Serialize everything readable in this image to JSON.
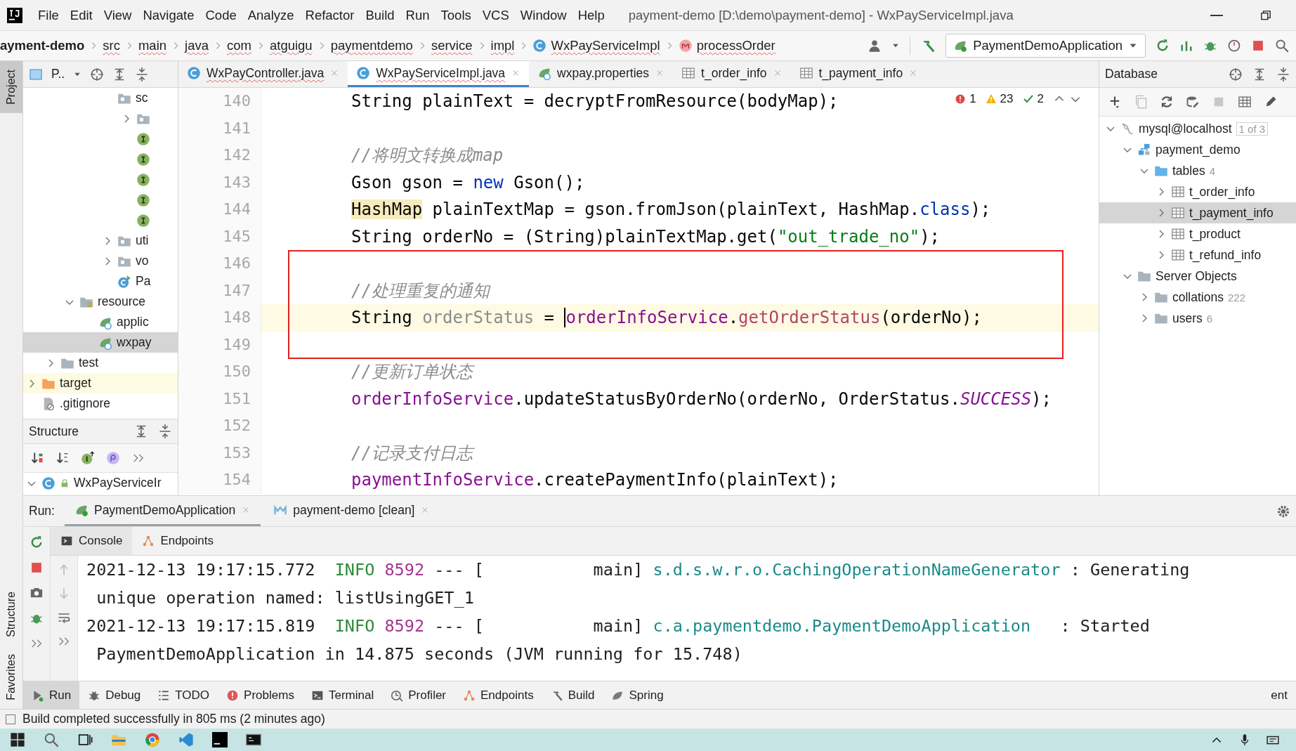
{
  "window": {
    "title": "payment-demo [D:\\demo\\payment-demo] - WxPayServiceImpl.java"
  },
  "menu": [
    "File",
    "Edit",
    "View",
    "Navigate",
    "Code",
    "Analyze",
    "Refactor",
    "Build",
    "Run",
    "Tools",
    "VCS",
    "Window",
    "Help"
  ],
  "breadcrumbs": [
    {
      "label": "ayment-demo",
      "kind": "project"
    },
    {
      "label": "src",
      "kind": "folder"
    },
    {
      "label": "main",
      "kind": "folder"
    },
    {
      "label": "java",
      "kind": "folder"
    },
    {
      "label": "com",
      "kind": "folder"
    },
    {
      "label": "atguigu",
      "kind": "folder"
    },
    {
      "label": "paymentdemo",
      "kind": "folder"
    },
    {
      "label": "service",
      "kind": "folder"
    },
    {
      "label": "impl",
      "kind": "folder"
    },
    {
      "label": "WxPayServiceImpl",
      "kind": "class"
    },
    {
      "label": "processOrder",
      "kind": "method"
    }
  ],
  "run_config": {
    "label": "PaymentDemoApplication"
  },
  "left_stripe": [
    {
      "label": "Project",
      "selected": true,
      "kind": "top"
    },
    {
      "label": "Structure",
      "selected": false,
      "kind": "bottom"
    },
    {
      "label": "Favorites",
      "selected": false,
      "kind": "bottom"
    }
  ],
  "project_panel": {
    "title": "P..",
    "tree": [
      {
        "children": [
          {
            "children": [
              {
                "children": [
                  {
                    "children": [
                      {
                        "label": "sc",
                        "kind": "package",
                        "selected": false,
                        "children": [
                          {
                            "kind": "package",
                            "expanded": false,
                            "selected": false
                          },
                          {
                            "kind": "interface",
                            "selected": false
                          },
                          {
                            "kind": "interface",
                            "selected": false
                          },
                          {
                            "kind": "interface",
                            "selected": false
                          },
                          {
                            "kind": "interface",
                            "selected": false
                          },
                          {
                            "kind": "interface",
                            "selected": false
                          }
                        ]
                      },
                      {
                        "label": "uti",
                        "kind": "package",
                        "expanded": false,
                        "selected": false
                      },
                      {
                        "label": "vo",
                        "kind": "package",
                        "expanded": false,
                        "selected": false
                      },
                      {
                        "label": "Pa",
                        "kind": "spring-class",
                        "selected": false
                      }
                    ]
                  }
                ]
              },
              {
                "label": "resource",
                "kind": "resources",
                "expanded": true,
                "selected": false,
                "children": [
                  {
                    "label": "applic",
                    "kind": "spring-file",
                    "selected": false
                  },
                  {
                    "label": "wxpay",
                    "kind": "spring-file",
                    "selected": true
                  }
                ]
              }
            ]
          },
          {
            "label": "test",
            "kind": "folder",
            "expanded": false,
            "selected": false
          }
        ]
      },
      {
        "label": "target",
        "kind": "excluded-folder",
        "expanded": false,
        "selected": false
      },
      {
        "label": ".gitignore",
        "kind": "ignore-file",
        "selected": false
      }
    ]
  },
  "structure_panel": {
    "title": "Structure",
    "tree": [
      {
        "label": "WxPayServiceIr",
        "kind": "class-locked",
        "expanded": true,
        "selected": false
      }
    ]
  },
  "editor": {
    "tabs": [
      {
        "label": "WxPayController.java",
        "kind": "class",
        "selected": false
      },
      {
        "label": "WxPayServiceImpl.java",
        "kind": "class",
        "selected": true
      },
      {
        "label": "wxpay.properties",
        "kind": "spring-file",
        "selected": false
      },
      {
        "label": "t_order_info",
        "kind": "table",
        "selected": false
      },
      {
        "label": "t_payment_info",
        "kind": "table",
        "selected": false
      }
    ],
    "inspections": {
      "errors": "1",
      "warnings": "23",
      "weak_warnings": "2"
    },
    "lines": [
      {
        "number": "140",
        "current": false,
        "in_box": false,
        "tokens": [
          {
            "kind": "plain",
            "text": "String plainText = decryptFromResource(bodyMap);"
          }
        ]
      },
      {
        "number": "141",
        "current": false,
        "in_box": false
      },
      {
        "number": "142",
        "current": false,
        "in_box": false,
        "tokens": [
          {
            "kind": "comment",
            "text": "//将明文转换成map"
          }
        ]
      },
      {
        "number": "143",
        "current": false,
        "in_box": false,
        "tokens": [
          {
            "kind": "plain",
            "text": "Gson gson = "
          },
          {
            "kind": "keyword",
            "text": "new"
          },
          {
            "kind": "plain",
            "text": " Gson();"
          }
        ]
      },
      {
        "number": "144",
        "current": false,
        "in_box": false,
        "tokens": [
          {
            "kind": "warning",
            "text": "HashMap"
          },
          {
            "kind": "plain",
            "text": " plainTextMap = gson.fromJson(plainText, HashMap."
          },
          {
            "kind": "keyword",
            "text": "class"
          },
          {
            "kind": "plain",
            "text": ");"
          }
        ]
      },
      {
        "number": "145",
        "current": false,
        "in_box": false,
        "tokens": [
          {
            "kind": "plain",
            "text": "String orderNo = (String)plainTextMap.get("
          },
          {
            "kind": "string",
            "text": "\"out_trade_no\""
          },
          {
            "kind": "plain",
            "text": ");"
          }
        ]
      },
      {
        "number": "146",
        "current": false,
        "in_box": true
      },
      {
        "number": "147",
        "current": false,
        "in_box": true,
        "tokens": [
          {
            "kind": "comment",
            "text": "//处理重复的通知"
          }
        ]
      },
      {
        "number": "148",
        "current": true,
        "in_box": true,
        "tokens": [
          {
            "kind": "plain",
            "text": "String "
          },
          {
            "kind": "unused",
            "text": "orderStatus"
          },
          {
            "kind": "plain",
            "text": " = "
          },
          {
            "kind": "field",
            "text": "orderInfoService"
          },
          {
            "kind": "plain",
            "text": "."
          },
          {
            "kind": "method",
            "text": "getOrderStatus"
          },
          {
            "kind": "plain",
            "text": "(orderNo);"
          }
        ]
      },
      {
        "number": "149",
        "current": false,
        "in_box": true
      },
      {
        "number": "150",
        "current": false,
        "in_box": false,
        "tokens": [
          {
            "kind": "comment",
            "text": "//更新订单状态"
          }
        ]
      },
      {
        "number": "151",
        "current": false,
        "in_box": false,
        "tokens": [
          {
            "kind": "field",
            "text": "orderInfoService"
          },
          {
            "kind": "plain",
            "text": ".updateStatusByOrderNo(orderNo, OrderStatus."
          },
          {
            "kind": "constant",
            "text": "SUCCESS"
          },
          {
            "kind": "plain",
            "text": ");"
          }
        ]
      },
      {
        "number": "152",
        "current": false,
        "in_box": false
      },
      {
        "number": "153",
        "current": false,
        "in_box": false,
        "tokens": [
          {
            "kind": "comment",
            "text": "//记录支付日志"
          }
        ]
      },
      {
        "number": "154",
        "current": false,
        "in_box": false,
        "tokens": [
          {
            "kind": "field",
            "text": "paymentInfoService"
          },
          {
            "kind": "plain",
            "text": ".createPaymentInfo(plainText);"
          }
        ]
      }
    ]
  },
  "database_panel": {
    "title": "Database",
    "tree": [
      {
        "label": "mysql@localhost",
        "badge": "1 of 3",
        "kind": "connection",
        "expanded": true,
        "selected": false,
        "children": [
          {
            "label": "payment_demo",
            "kind": "schema",
            "expanded": true,
            "selected": false,
            "children": [
              {
                "label": "tables",
                "count": "4",
                "kind": "folder-blue",
                "expanded": true,
                "selected": false,
                "children": [
                  {
                    "label": "t_order_info",
                    "kind": "table",
                    "expanded": false,
                    "selected": false
                  },
                  {
                    "label": "t_payment_info",
                    "kind": "table",
                    "expanded": false,
                    "selected": true
                  },
                  {
                    "label": "t_product",
                    "kind": "table",
                    "expanded": false,
                    "selected": false
                  },
                  {
                    "label": "t_refund_info",
                    "kind": "table",
                    "expanded": false,
                    "selected": false
                  }
                ]
              }
            ]
          },
          {
            "label": "Server Objects",
            "kind": "folder",
            "expanded": true,
            "selected": false,
            "children": [
              {
                "label": "collations",
                "count": "222",
                "kind": "folder",
                "expanded": false,
                "selected": false
              },
              {
                "label": "users",
                "count": "6",
                "kind": "folder",
                "expanded": false,
                "selected": false
              }
            ]
          }
        ]
      }
    ]
  },
  "run_panel": {
    "label": "Run:",
    "tabs": [
      {
        "label": "PaymentDemoApplication",
        "kind": "spring-run",
        "selected": true
      },
      {
        "label": "payment-demo [clean]",
        "kind": "module",
        "selected": false
      }
    ],
    "subtabs": [
      {
        "label": "Console",
        "kind": "console",
        "selected": true
      },
      {
        "label": "Endpoints",
        "kind": "endpoints",
        "selected": false
      }
    ],
    "console": [
      {
        "tokens": [
          {
            "kind": "plain",
            "text": "2021-12-13 19:17:15.772  "
          },
          {
            "kind": "info",
            "text": "INFO "
          },
          {
            "kind": "pid",
            "text": "8592"
          },
          {
            "kind": "plain",
            "text": " --- [           main] "
          },
          {
            "kind": "logger",
            "text": "s.d.s.w.r.o.CachingOperationNameGenerator"
          },
          {
            "kind": "plain",
            "text": " : Generating"
          }
        ]
      },
      {
        "tokens": [
          {
            "kind": "plain",
            "text": " unique operation named: listUsingGET_1"
          }
        ]
      },
      {
        "tokens": [
          {
            "kind": "plain",
            "text": "2021-12-13 19:17:15.819  "
          },
          {
            "kind": "info",
            "text": "INFO "
          },
          {
            "kind": "pid",
            "text": "8592"
          },
          {
            "kind": "plain",
            "text": " --- [           main] "
          },
          {
            "kind": "logger",
            "text": "c.a.paymentdemo.PaymentDemoApplication"
          },
          {
            "kind": "plain",
            "text": "   : Started"
          }
        ]
      },
      {
        "tokens": [
          {
            "kind": "plain",
            "text": " PaymentDemoApplication in 14.875 seconds (JVM running for 15.748)"
          }
        ]
      }
    ]
  },
  "tool_tabs": [
    {
      "label": "Run",
      "kind": "run",
      "selected": true
    },
    {
      "label": "Debug",
      "kind": "bug",
      "selected": false
    },
    {
      "label": "TODO",
      "kind": "list",
      "selected": false
    },
    {
      "label": "Problems",
      "kind": "problems",
      "selected": false
    },
    {
      "label": "Terminal",
      "kind": "terminal",
      "selected": false
    },
    {
      "label": "Profiler",
      "kind": "profiler",
      "selected": false
    },
    {
      "label": "Endpoints",
      "kind": "endpoints",
      "selected": false
    },
    {
      "label": "Build",
      "kind": "hammer",
      "selected": false
    },
    {
      "label": "Spring",
      "kind": "leaf",
      "selected": false
    }
  ],
  "tool_tabs_right": [
    {
      "label": "ent",
      "selected": false
    }
  ],
  "status_bar": {
    "message": "Build completed successfully in 805 ms (2 minutes ago)"
  }
}
